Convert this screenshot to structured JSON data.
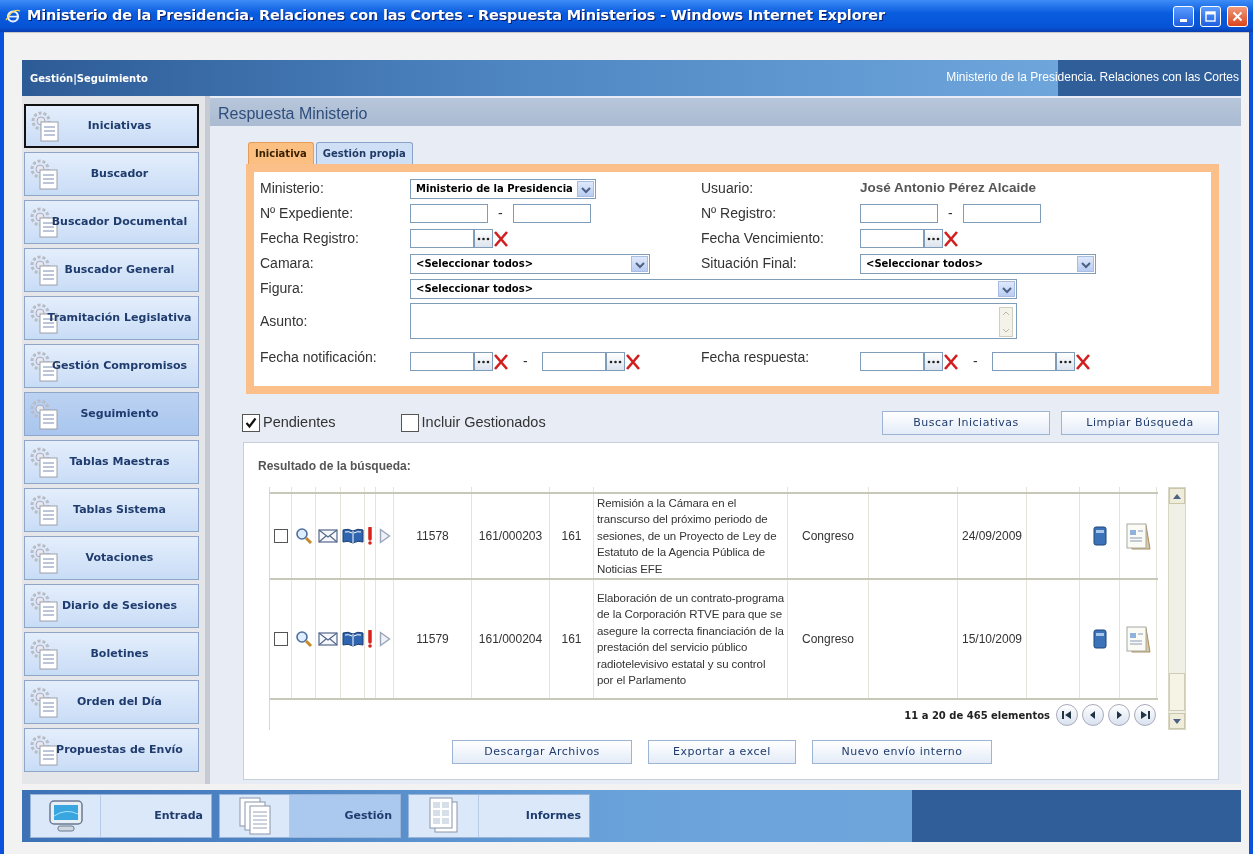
{
  "window": {
    "title": "Ministerio de la Presidencia. Relaciones con las Cortes - Respuesta Ministerios - Windows Internet Explorer"
  },
  "header": {
    "breadcrumb": "Gestión|Seguimiento",
    "organization": "Ministerio de la Presidencia. Relaciones con las Cortes"
  },
  "sidebar": {
    "items": [
      {
        "label": "Iniciativas",
        "selected": false,
        "focused": true
      },
      {
        "label": "Buscador",
        "selected": false,
        "focused": false
      },
      {
        "label": "Buscador Documental",
        "selected": false,
        "focused": false
      },
      {
        "label": "Buscador General",
        "selected": false,
        "focused": false
      },
      {
        "label": "Tramitación Legislativa",
        "selected": false,
        "focused": false
      },
      {
        "label": "Gestión Compromisos",
        "selected": false,
        "focused": false
      },
      {
        "label": "Seguimiento",
        "selected": true,
        "focused": false
      },
      {
        "label": "Tablas Maestras",
        "selected": false,
        "focused": false
      },
      {
        "label": "Tablas Sistema",
        "selected": false,
        "focused": false
      },
      {
        "label": "Votaciones",
        "selected": false,
        "focused": false
      },
      {
        "label": "Diario de Sesiones",
        "selected": false,
        "focused": false
      },
      {
        "label": "Boletines",
        "selected": false,
        "focused": false
      },
      {
        "label": "Orden del Día",
        "selected": false,
        "focused": false
      },
      {
        "label": "Propuestas de Envío",
        "selected": false,
        "focused": false
      }
    ]
  },
  "page_title": "Respuesta Ministerio",
  "tabs": [
    {
      "label": "Iniciativa",
      "selected": true
    },
    {
      "label": "Gestión propia",
      "selected": false
    }
  ],
  "form": {
    "fields": [
      {
        "label": "Ministerio:",
        "kind": "select_compact",
        "value": "Ministerio de la Presidencia"
      },
      {
        "label": "Usuario:",
        "kind": "readonly",
        "value": "José Antonio Pérez Alcaide"
      },
      {
        "label": "Nº Expediente:",
        "kind": "range",
        "separator": "-"
      },
      {
        "label": "Nº Registro:",
        "kind": "range",
        "separator": "-"
      },
      {
        "label": "Fecha Registro:",
        "kind": "date"
      },
      {
        "label": "Fecha Vencimiento:",
        "kind": "date"
      },
      {
        "label": "Camara:",
        "kind": "select",
        "value": "<Seleccionar todos>"
      },
      {
        "label": "Situación Final:",
        "kind": "select",
        "value": "<Seleccionar todos>"
      },
      {
        "label": "Figura:",
        "kind": "select_wide",
        "value": "<Seleccionar todos>"
      },
      {
        "label": "Asunto:",
        "kind": "textarea"
      },
      {
        "label": "Fecha notificación:",
        "kind": "date_range",
        "separator": "-"
      },
      {
        "label": "Fecha respuesta:",
        "kind": "date_range",
        "separator": "-"
      }
    ]
  },
  "filters": [
    {
      "label": "Pendientes",
      "checked": true
    },
    {
      "label": "Incluir Gestionados",
      "checked": false
    }
  ],
  "search_buttons": [
    "Buscar Iniciativas",
    "Limpiar Búsqueda"
  ],
  "results": {
    "title": "Resultado de la búsqueda:",
    "rows": [
      {
        "selected": false,
        "id": "11578",
        "expediente": "161/000203",
        "numero": "161",
        "asunto": "Remisión a la Cámara en el transcurso del próximo periodo de sesiones, de un Proyecto de Ley de Estatuto de la Agencia Pública de Noticias EFE",
        "camara": "Congreso",
        "fecha": "24/09/2009"
      },
      {
        "selected": false,
        "id": "11579",
        "expediente": "161/000204",
        "numero": "161",
        "asunto": "Elaboración de un contrato-programa de la Corporación RTVE para que se asegure la correcta financiación de la prestación del servicio público radiotelevisivo estatal y su control por el Parlamento",
        "camara": "Congreso",
        "fecha": "15/10/2009"
      }
    ],
    "pagination": "11 a 20 de 465 elementos"
  },
  "actions": [
    "Descargar Archivos",
    "Exportar a excel",
    "Nuevo envío interno"
  ],
  "bottom_tabs": [
    {
      "label": "Entrada",
      "selected": false,
      "kind": "monitor"
    },
    {
      "label": "Gestión",
      "selected": true,
      "kind": "documents"
    },
    {
      "label": "Informes",
      "selected": false,
      "kind": "report"
    }
  ]
}
